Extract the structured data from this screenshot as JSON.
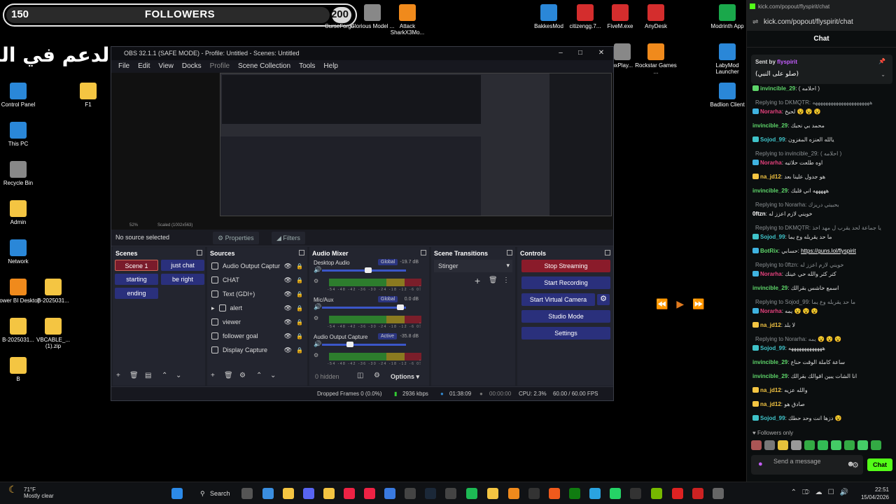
{
  "overlay": {
    "count_left": "150",
    "label": "FOLLOWERS",
    "count_right": "200",
    "arabic_banner": "رابط الدعم في البايو"
  },
  "desktop_icons": [
    {
      "label": "Control Panel"
    },
    {
      "label": "F1"
    },
    {
      "label": "This PC"
    },
    {
      "label": "Recycle Bin"
    },
    {
      "label": "Admin"
    },
    {
      "label": "Network"
    },
    {
      "label": "Power BI Desktop"
    },
    {
      "label": "B-2025031..."
    },
    {
      "label": "B-2025031..."
    },
    {
      "label": "VBCABLE_... (1).zip"
    },
    {
      "label": "B"
    },
    {
      "label": "CurseForge"
    },
    {
      "label": "Glorious Model ..."
    },
    {
      "label": "Attack SharkX3Mo..."
    },
    {
      "label": "BakkesMod"
    },
    {
      "label": "citizengg.7..."
    },
    {
      "label": "FiveM.exe"
    },
    {
      "label": "AnyDesk"
    },
    {
      "label": "Modrinth App"
    },
    {
      "label": "LabyMod Launcher"
    },
    {
      "label": "Badlion Client"
    },
    {
      "label": "Rockstar Games ..."
    },
    {
      "label": "oxPlay..."
    }
  ],
  "obs": {
    "title": "OBS 32.1.1 (SAFE MODE) - Profile: Untitled - Scenes: Untitled",
    "menu": [
      "File",
      "Edit",
      "View",
      "Docks",
      "Profile",
      "Scene Collection",
      "Tools",
      "Help"
    ],
    "no_source": "No source selected",
    "properties_label": "Properties",
    "filters_label": "Filters",
    "preview_zoom": "52%",
    "preview_scale": "Scaled (1002x563)",
    "scenes": {
      "title": "Scenes",
      "items": [
        "Scene 1",
        "just chat",
        "starting",
        "be right",
        "ending"
      ]
    },
    "sources": {
      "title": "Sources",
      "items": [
        "Audio Output Captur",
        "CHAT",
        "Text (GDI+)",
        "alert",
        "viewer",
        "follower goal",
        "Display Capture"
      ]
    },
    "mixer": {
      "title": "Audio Mixer",
      "channels": [
        {
          "name": "Desktop Audio",
          "badge": "Global",
          "db": "-19.7 dB",
          "level": 0.55
        },
        {
          "name": "Mic/Aux",
          "badge": "Global",
          "db": "0.0 dB",
          "level": 0.93
        },
        {
          "name": "Audio Output Capture",
          "badge": "Active",
          "db": "-35.8 dB",
          "level": 0.33
        }
      ],
      "tick_labels": "-54 -48 -42 -36 -30 -24 -18 -12 -6 0",
      "hidden": "0 hidden",
      "options": "Options"
    },
    "transitions": {
      "title": "Scene Transitions",
      "selected": "Stinger"
    },
    "controls": {
      "title": "Controls",
      "buttons": [
        "Stop Streaming",
        "Start Recording",
        "Start Virtual Camera",
        "Studio Mode",
        "Settings"
      ]
    },
    "status": {
      "dropped": "Dropped Frames 0 (0.0%)",
      "bitrate": "2936 kbps",
      "stream_time": "01:38:09",
      "rec_time": "00:00:00",
      "cpu": "CPU: 2.3%",
      "fps": "60.00 / 60.00 FPS"
    }
  },
  "chat": {
    "url_small": "kick.com/popout/flyspirit/chat",
    "url": "kick.com/popout/flyspirit/chat",
    "title": "Chat",
    "pinned": {
      "sent_by": "Sent by",
      "user": "flyspirit",
      "text": "(صلو على النبي)"
    },
    "messages": [
      {
        "user": "invincible_29",
        "text": "( احلامه )",
        "color": "#5ed66a",
        "badge": "#5ed66a"
      },
      {
        "reply": "Replying to DKMQTR: ههههههههههههههههههههههه"
      },
      {
        "user": "Norarha",
        "text": "لحيخ 😵 😵 😵",
        "color": "#e5417d",
        "badge": "#3fb3e0"
      },
      {
        "user": "invincible_29",
        "text": "محمد بي نحبك",
        "color": "#5ed66a",
        "badge": ""
      },
      {
        "user": "Sojod_99",
        "text": "يالله العنزه المفزون",
        "color": "#3fc3c9",
        "badge": "#3fc3c9"
      },
      {
        "reply": "Replying to invincible_29: ( احلامه )"
      },
      {
        "user": "Norarha",
        "text": "اوه طلعت حلاتيه",
        "color": "#e5417d",
        "badge": "#3fb3e0"
      },
      {
        "user": "na_jd12",
        "text": "هو جدول علينا بعد",
        "color": "#f4c542",
        "badge": "#f4c542"
      },
      {
        "user": "invincible_29",
        "text": "هههههه اني قلبك",
        "color": "#5ed66a",
        "badge": ""
      },
      {
        "reply": "Replying to Norarha: بحبيتي دريزك"
      },
      {
        "user": "0ftzn",
        "text": "خويني لازم اعزز له",
        "color": "#fff",
        "badge": ""
      },
      {
        "reply": "Replying to DKMQTR: يا جماعة لحد يقرب ل مهد اخذ"
      },
      {
        "user": "Sojod_99",
        "text": "ما حد يقربله وع يما",
        "color": "#3fc3c9",
        "badge": "#3fc3c9"
      },
      {
        "user": "BotRix",
        "text": "حسابي: ",
        "link": "https://guns.lol/flyspirit",
        "color": "#5ed66a",
        "badge": "#3fb3e0"
      },
      {
        "reply": "Replying to 0ftzn: خويني لازم اعزز له"
      },
      {
        "user": "Norarha",
        "text": "كتر كثر والله حي عينك",
        "color": "#e5417d",
        "badge": "#3fb3e0"
      },
      {
        "user": "invincible_29",
        "text": "اسمع خاشس بقرالك",
        "color": "#5ed66a",
        "badge": ""
      },
      {
        "reply": "Replying to Sojod_99: ما حد يقربله وع يما"
      },
      {
        "user": "Norarha",
        "text": "يمه 😵 😵 😵",
        "color": "#e5417d",
        "badge": "#3fb3e0"
      },
      {
        "user": "na_jd12",
        "text": "لا بلد",
        "color": "#f4c542",
        "badge": "#f4c542"
      },
      {
        "reply": "Replying to Norarha: يمه 😵 😵 😵"
      },
      {
        "user": "Sojod_99",
        "text": "هههههههههههههه",
        "color": "#3fc3c9",
        "badge": "#3fc3c9"
      },
      {
        "user": "invincible_29",
        "text": "ساعة كاملة الوقت حناع",
        "color": "#5ed66a",
        "badge": ""
      },
      {
        "user": "invincible_29",
        "text": "انا الشات يبين اقوالك بقرالك",
        "color": "#5ed66a",
        "badge": ""
      },
      {
        "user": "na_jd12",
        "text": "والله عزيه",
        "color": "#f4c542",
        "badge": "#f4c542"
      },
      {
        "user": "na_jd12",
        "text": "صادق هو",
        "color": "#f4c542",
        "badge": "#f4c542"
      },
      {
        "user": "Sojod_99",
        "text": "دزها انت وحد حطك 😵",
        "color": "#3fc3c9",
        "badge": "#3fc3c9"
      }
    ],
    "followers_only": "Followers only",
    "input_placeholder": "Send a message",
    "send_label": "Chat"
  },
  "taskbar": {
    "temp": "71°F",
    "weather": "Mostly clear",
    "search": "Search",
    "time": "22:51",
    "date": "15/04/2026"
  }
}
